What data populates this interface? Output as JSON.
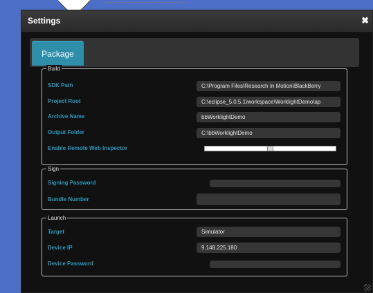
{
  "dialog": {
    "title": "Settings",
    "close_icon": "close-icon"
  },
  "tabs": [
    {
      "label": "Package",
      "active": true
    }
  ],
  "build": {
    "legend": "Build",
    "sdk_path": {
      "label": "SDK Path",
      "value": "C:\\Program Files\\Research In Motion\\BlackBerry"
    },
    "project_root": {
      "label": "Project Root",
      "value": "C:\\eclipse_5.0.5.1\\workspace\\WorklightDemo\\ap"
    },
    "archive_name": {
      "label": "Archive Name",
      "value": "bbWorklightDemo"
    },
    "output_folder": {
      "label": "Output Folder",
      "value": "C:\\bbWorklightDemo"
    },
    "remote_inspector": {
      "label": "Enable Remote Web Inspector",
      "slider_position": 0.5
    }
  },
  "sign": {
    "legend": "Sign",
    "signing_password": {
      "label": "Signing Password",
      "value": ""
    },
    "bundle_number": {
      "label": "Bundle Number",
      "value": ""
    }
  },
  "launch": {
    "legend": "Launch",
    "target": {
      "label": "Target",
      "value": "Simulator"
    },
    "device_ip": {
      "label": "Device IP",
      "value": "9.148.225.180"
    },
    "device_password": {
      "label": "Device Password",
      "value": ""
    }
  },
  "colors": {
    "background": "#4d6fc8",
    "dialog": "#111111",
    "label": "#2d99bd",
    "tab_active": "#2f8faa"
  }
}
